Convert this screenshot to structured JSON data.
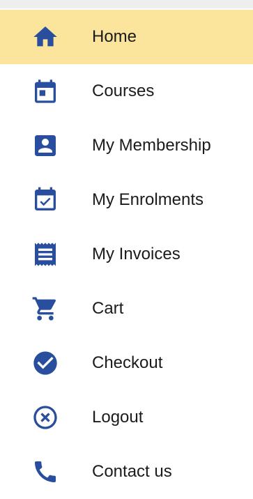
{
  "theme": {
    "icon_color": "#2a4e9e",
    "active_background": "#fbe49c",
    "text_color": "#1b1b1b"
  },
  "menu": {
    "items": [
      {
        "label": "Home",
        "icon": "home-icon",
        "active": true
      },
      {
        "label": "Courses",
        "icon": "calendar-icon",
        "active": false
      },
      {
        "label": "My Membership",
        "icon": "id-card-icon",
        "active": false
      },
      {
        "label": "My Enrolments",
        "icon": "calendar-check-icon",
        "active": false
      },
      {
        "label": "My Invoices",
        "icon": "receipt-icon",
        "active": false
      },
      {
        "label": "Cart",
        "icon": "cart-icon",
        "active": false
      },
      {
        "label": "Checkout",
        "icon": "check-circle-icon",
        "active": false
      },
      {
        "label": "Logout",
        "icon": "close-circle-icon",
        "active": false
      },
      {
        "label": "Contact us",
        "icon": "phone-icon",
        "active": false
      }
    ]
  }
}
